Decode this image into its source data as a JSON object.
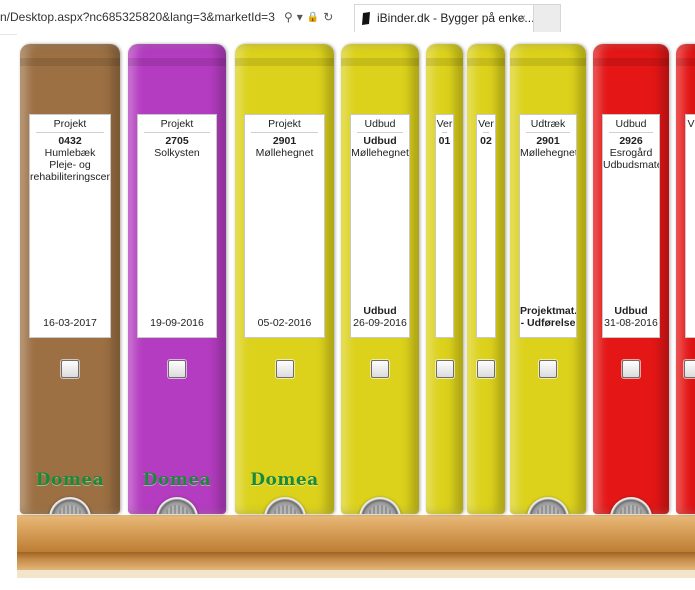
{
  "browser": {
    "url_text": "n/Desktop.aspx?nc685325820&lang=3&marketId=3",
    "tab_title": "iBinder.dk - Bygger på enke...",
    "tab_close": "×",
    "search_glyph": "⚲",
    "dropdown_glyph": "▾",
    "lock_glyph": "🔒",
    "refresh_glyph": "↻"
  },
  "binders": [
    {
      "color": "#9c7043",
      "type": "Projekt",
      "number": "0432",
      "title": "Humlebæk Pleje- og rehabiliteringscenter",
      "sub": "",
      "date": "16-03-2017",
      "brand": "Domea"
    },
    {
      "color": "#b43cc0",
      "type": "Projekt",
      "number": "2705",
      "title": "Solkysten",
      "sub": "",
      "date": "19-09-2016",
      "brand": "Domea"
    },
    {
      "color": "#dcd21c",
      "type": "Projekt",
      "number": "2901",
      "title": "Møllehegnet",
      "sub": "",
      "date": "05-02-2016",
      "brand": "Domea"
    },
    {
      "color": "#dcd21c",
      "type": "Udbud",
      "number": "Udbud",
      "title": "Møllehegnet",
      "sub": "Udbud",
      "date": "26-09-2016",
      "brand": ""
    },
    {
      "color": "#dcd21c",
      "type": "Ver",
      "number": "01",
      "title": "",
      "sub": "",
      "date": "",
      "brand": ""
    },
    {
      "color": "#dcd21c",
      "type": "Ver",
      "number": "02",
      "title": "",
      "sub": "",
      "date": "",
      "brand": ""
    },
    {
      "color": "#dcd21c",
      "type": "Udtræk",
      "number": "2901",
      "title": "Møllehegnet",
      "sub": "Projektmat...",
      "date": "- Udførelse",
      "brand": ""
    },
    {
      "color": "#e41616",
      "type": "Udbud",
      "number": "2926",
      "title": "Esrogård Udbudsmateriale",
      "sub": "Udbud",
      "date": "31-08-2016",
      "brand": ""
    },
    {
      "color": "#e41616",
      "type": "V",
      "number": "",
      "title": "",
      "sub": "",
      "date": "",
      "brand": ""
    }
  ]
}
